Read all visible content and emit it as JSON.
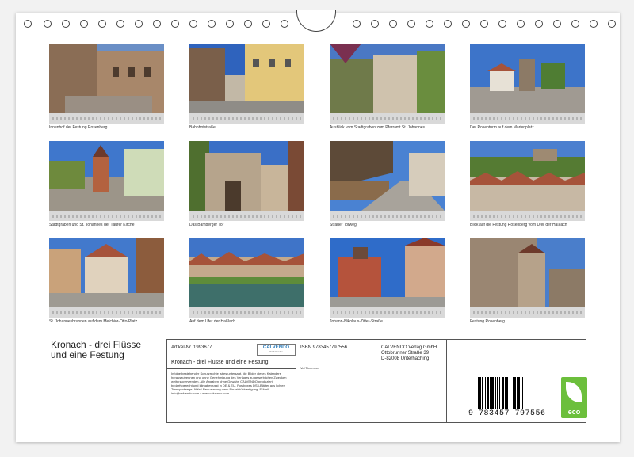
{
  "calendar_title_line1": "Kronach - drei Flüsse",
  "calendar_title_line2": "und eine Festung",
  "photos": [
    {
      "caption": "Innenhof der Festung Rosenberg"
    },
    {
      "caption": "Bahnhofstraße"
    },
    {
      "caption": "Ausblick vom Stadtgraben zum Pfarramt St. Johannes"
    },
    {
      "caption": "Der Rosenturm auf dem Marienplatz"
    },
    {
      "caption": "Stadtgraben und St. Johannes der Täufer Kirche"
    },
    {
      "caption": "Das Bamberger Tor"
    },
    {
      "caption": "Strauer Torweg"
    },
    {
      "caption": "Blick auf die Festung Rosenberg vom Ufer der Haßlach"
    },
    {
      "caption": "St. Johannesbrunnen auf dem Melchior-Otto-Platz"
    },
    {
      "caption": "Auf dem Ufer der Haßlach"
    },
    {
      "caption": "Johann-Nikolaus-Zitter-Straße"
    },
    {
      "caption": "Festung Rosenberg"
    }
  ],
  "info": {
    "artikel": "Artikel-Nr. 1993677",
    "logo_name": "CALVENDO",
    "logo_sub": "Ihr Kalender",
    "product_title": "Kronach - drei Flüsse und eine Festung",
    "legal": "Infolge bestehender Schutzrechte ist es untersagt, die Bilder dieses Kalenders herauszutrennen und ohne Genehmigung des Verlages zu gewerblichen Zwecken weiterzuverwenden. Alle Angaben ohne Gewähr. CALVENDO produziert bedarfsgerecht und klimabewusst in DE & EU. Postboxes DS3-Blätter aus lichter Transportwege. Abfall-Reduzierung dank Einzelstückfertigung. E-Mail: info@calvendo.com • www.calvendo.com",
    "isbn": "ISBN 9783457797556",
    "author": "Val Thoermer",
    "publisher_1": "CALVENDO Verlag GmbH",
    "publisher_2": "Ottobrunner Straße 39",
    "publisher_3": "D-82008 Unterhaching",
    "barcode_number": "9 783457 797556",
    "eco_label": "eco"
  },
  "colors": {
    "sky": "#3d74c9",
    "stone": "#a89880",
    "roof": "#a6533a",
    "green": "#5e8c3a"
  }
}
